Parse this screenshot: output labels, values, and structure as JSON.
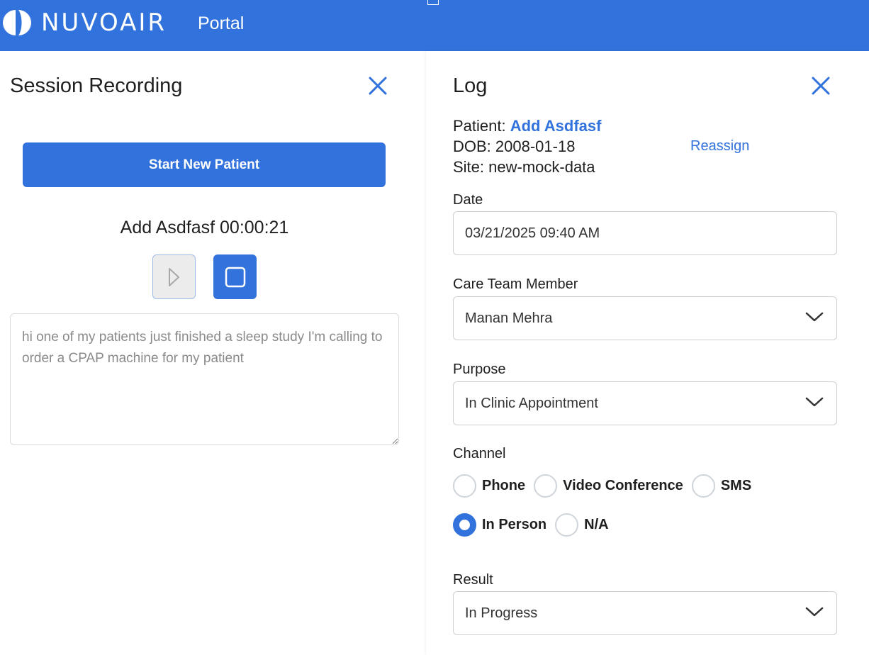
{
  "header": {
    "logo_text": "NUVOAIR",
    "portal_label": "Portal"
  },
  "session": {
    "title": "Session Recording",
    "start_button": "Start New Patient",
    "timer_text": "Add Asdfasf 00:00:21",
    "transcript": "hi one of my patients just finished a sleep study I'm calling to order a CPAP machine for my patient"
  },
  "log": {
    "title": "Log",
    "patient_label": "Patient:",
    "patient_name": "Add Asdfasf",
    "dob_text": "DOB: 2008-01-18",
    "site_text": "Site: new-mock-data",
    "reassign_label": "Reassign",
    "date_label": "Date",
    "date_value": "03/21/2025 09:40 AM",
    "care_team_label": "Care Team Member",
    "care_team_value": "Manan Mehra",
    "purpose_label": "Purpose",
    "purpose_value": "In Clinic Appointment",
    "channel_label": "Channel",
    "channels": {
      "phone": "Phone",
      "video": "Video Conference",
      "sms": "SMS",
      "in_person": "In Person",
      "na": "N/A"
    },
    "channel_selected": "In Person",
    "result_label": "Result",
    "result_value": "In Progress"
  },
  "colors": {
    "brand": "#3272dc"
  },
  "icons": [
    "nuvoair-logo-icon",
    "close-icon",
    "play-icon",
    "stop-icon",
    "chevron-down-icon"
  ]
}
